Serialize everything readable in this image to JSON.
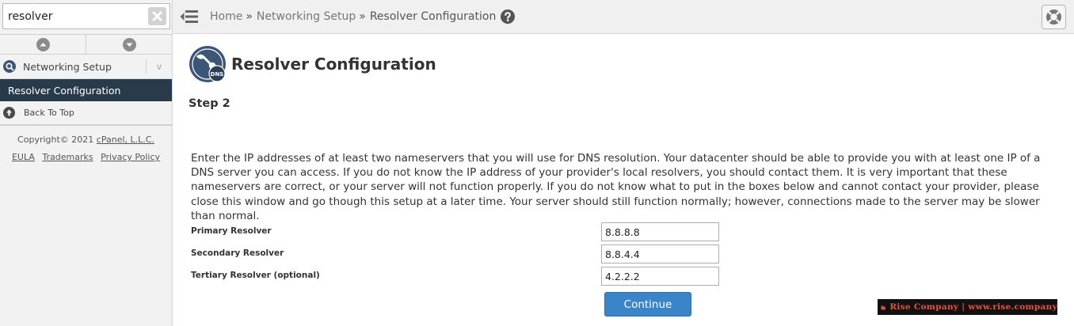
{
  "search": {
    "value": "resolver"
  },
  "sidebar": {
    "group_label": "Networking Setup",
    "group_caret": "v",
    "active_item": "Resolver Configuration",
    "back_to_top": "Back To Top"
  },
  "footer": {
    "copyright_prefix": "Copyright© 2021",
    "company": "cPanel, L.L.C.",
    "links": [
      "EULA",
      "Trademarks",
      "Privacy Policy"
    ]
  },
  "breadcrumb": {
    "home": "Home",
    "separator": "»",
    "parent": "Networking Setup",
    "current": "Resolver Configuration"
  },
  "page": {
    "title": "Resolver Configuration",
    "badge": "DNS",
    "step": "Step 2",
    "description": "Enter the IP addresses of at least two nameservers that you will use for DNS resolution. Your datacenter should be able to provide you with at least one IP of a DNS server you can access. If you do not know the IP address of your provider's local resolvers, you should contact them. It is very important that these nameservers are correct, or your server will not function properly. If you do not know what to put in the boxes below and cannot contact your provider, please close this window and go though this setup at a later time. Your server should still function normally; however, connections made to the server may be slower than normal."
  },
  "resolvers": [
    {
      "label": "Primary Resolver",
      "value": "8.8.8.8"
    },
    {
      "label": "Secondary Resolver",
      "value": "8.8.4.4"
    },
    {
      "label": "Tertiary Resolver (optional)",
      "value": "4.2.2.2"
    }
  ],
  "continue_label": "Continue",
  "watermark": "Rise Company | www.rise.company",
  "colors": {
    "active_nav_bg": "#293a4a",
    "primary_button": "#3a85c7",
    "page_icon": "#3c5677",
    "watermark_text": "#e8533a"
  },
  "icons": {
    "search_clear": "close-icon",
    "nav_up": "arrow-up-circle-icon",
    "nav_down": "arrow-down-circle-icon",
    "group": "networking-icon",
    "back_to_top": "arrow-up-circle-icon",
    "menu": "menu-toggle-icon",
    "help": "help-icon",
    "support": "lifebuoy-icon",
    "page": "dns-wrench-icon"
  }
}
